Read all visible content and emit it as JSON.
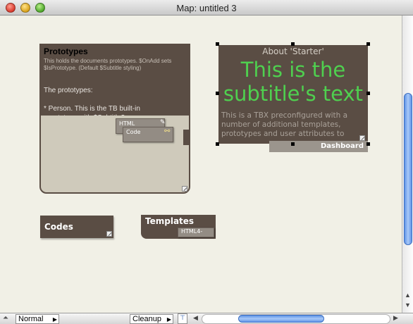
{
  "window": {
    "title": "Map: untitled 3"
  },
  "prototypes": {
    "title": "Prototypes",
    "description": "This holds the documents prototypes. $OnAdd sets $IsPrototype. (Default $Subtitle styling)",
    "body": "The prototypes:\n\n* Person. This is the TB built-in\n  prototype with $Subtitle?",
    "children": [
      {
        "label": "HTML"
      },
      {
        "label": "Code"
      }
    ]
  },
  "about": {
    "title": "About 'Starter'",
    "subtitle": "This is the subtitle's text",
    "body": "This is a TBX preconfigured with a number of additional templates, prototypes and user attributes to",
    "adornment_label": "Dashboard"
  },
  "codes": {
    "title": "Codes"
  },
  "templates": {
    "title": "Templates",
    "child": "HTML4-"
  },
  "bottombar": {
    "mode": "Normal",
    "cleanup": "Cleanup"
  }
}
